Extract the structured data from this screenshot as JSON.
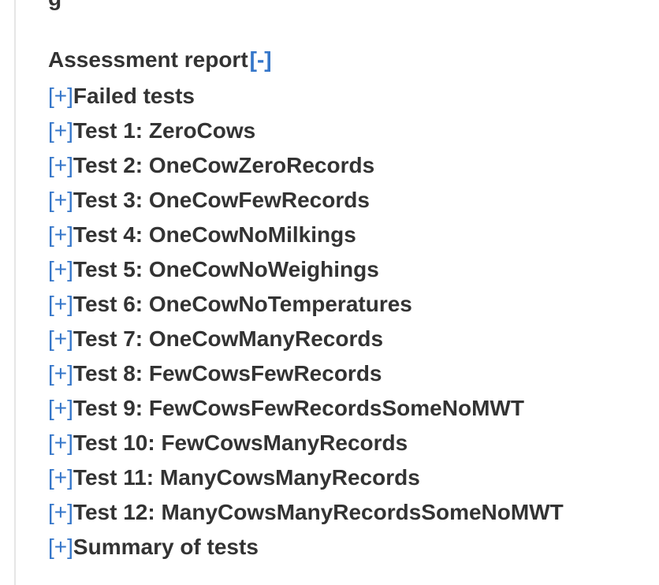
{
  "top_fragment": "g",
  "report": {
    "title": "Assessment report",
    "collapse_toggle": "[-]",
    "expand_toggle": "[+]",
    "items": [
      {
        "label": "Failed tests"
      },
      {
        "label": "Test 1: ZeroCows"
      },
      {
        "label": "Test 2: OneCowZeroRecords"
      },
      {
        "label": "Test 3: OneCowFewRecords"
      },
      {
        "label": "Test 4: OneCowNoMilkings"
      },
      {
        "label": "Test 5: OneCowNoWeighings"
      },
      {
        "label": "Test 6: OneCowNoTemperatures"
      },
      {
        "label": "Test 7: OneCowManyRecords"
      },
      {
        "label": "Test 8: FewCowsFewRecords"
      },
      {
        "label": "Test 9: FewCowsFewRecordsSomeNoMWT"
      },
      {
        "label": "Test 10: FewCowsManyRecords"
      },
      {
        "label": "Test 11: ManyCowsManyRecords"
      },
      {
        "label": "Test 12: ManyCowsManyRecordsSomeNoMWT"
      },
      {
        "label": "Summary of tests"
      }
    ]
  }
}
